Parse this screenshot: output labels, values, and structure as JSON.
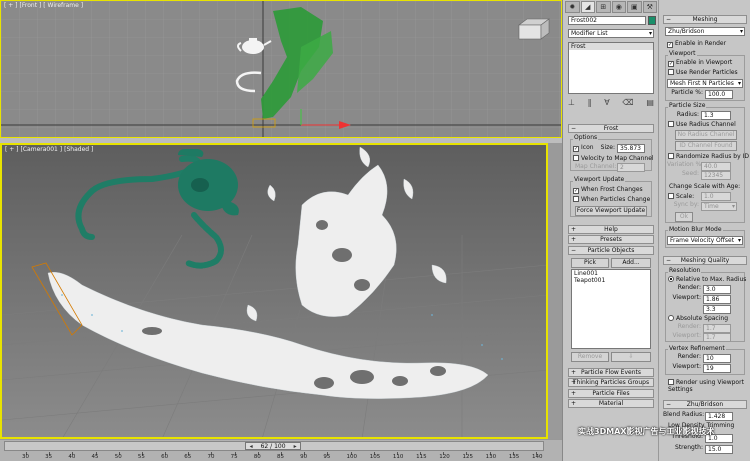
{
  "viewport_top": {
    "labels": [
      "[ + ]",
      "[Front ]",
      "[ Wireframe ]"
    ]
  },
  "viewport_camera": {
    "labels": [
      "[ + ]",
      "[Camera001 ]",
      "[Shaded ]"
    ]
  },
  "timeline": {
    "position": "62 / 100",
    "current_frame": 62,
    "total_frames": 100,
    "ticks": [
      "30",
      "35",
      "40",
      "45",
      "50",
      "55",
      "60",
      "65",
      "70",
      "75",
      "80",
      "85",
      "90",
      "95",
      "100",
      "105",
      "110",
      "115",
      "120",
      "125",
      "130",
      "135",
      "140"
    ]
  },
  "command_panel": {
    "tabs": [
      "create-icon",
      "modify-icon",
      "hierarchy-icon",
      "motion-icon",
      "display-icon",
      "utilities-icon"
    ],
    "object_name": "Frost002",
    "object_color": "#1a8f6a",
    "modifier_list": "Modifier List",
    "stack_item": "Frost",
    "frost_rollout": {
      "title": "Frost",
      "options_label": "Options",
      "icon_label": "Icon",
      "size_label": "Size:",
      "size_value": "35.873",
      "velocity_map": "Velocity to Map Channel",
      "map_channel_label": "Map Channel:",
      "map_channel_value": "2",
      "viewport_update_label": "Viewport Update",
      "when_frost_changes": "When Frost Changes",
      "when_particles_change": "When Particles Change",
      "force_update": "Force Viewport Update"
    },
    "rollouts_closed": [
      "Help",
      "Presets"
    ],
    "particle_objects": {
      "title": "Particle Objects",
      "pick": "Pick",
      "add": "Add...",
      "items": [
        "Line001",
        "Teapot001"
      ],
      "remove": "Remove"
    },
    "rollouts_bottom": [
      "Particle Flow Events",
      "Thinking Particles Groups",
      "Particle Files",
      "Material"
    ]
  },
  "meshing_panel": {
    "title": "Meshing",
    "method": "Zhu/Bridson",
    "enable_in_render": "Enable in Render",
    "viewport_label": "Viewport",
    "enable_in_viewport": "Enable in Viewport",
    "use_render_particles": "Use Render Particles",
    "mesh_mode": "Mesh First N Particles",
    "particle_pct_label": "Particle %:",
    "particle_pct_value": "100.0",
    "particle_size_label": "Particle Size",
    "radius_label": "Radius:",
    "radius_value": "1.3",
    "use_radius_channel": "Use Radius Channel",
    "no_radius_channel": "No Radius Channel",
    "id_channel_found": "ID Channel Found",
    "randomize_by_id": "Randomize Radius by ID",
    "variation_label": "Variation %:",
    "variation_value": "40.0",
    "seed_label": "Seed:",
    "seed_value": "12345",
    "change_scale_label": "Change Scale with Age:",
    "scale_label": "Scale:",
    "scale_value": "1.0",
    "sync_label": "Sync by:",
    "sync_value": "Time",
    "ok": "Ok",
    "motion_blur_label": "Motion Blur Mode",
    "motion_blur_value": "Frame Velocity Offset",
    "meshing_quality_title": "Meshing Quality",
    "resolution_label": "Resolution",
    "relative_label": "Relative to Max. Radius",
    "render_label": "Render:",
    "render_value": "3.0",
    "viewport_field_label": "Viewport:",
    "viewport_value": "1.86",
    "viewport_value2": "3.3",
    "absolute_spacing": "Absolute Spacing",
    "abs_render_value": "1.7",
    "abs_viewport_value": "1.7",
    "vertex_refinement": "Vertex Refinement",
    "vr_render_value": "10",
    "vr_viewport_value": "19",
    "render_using_viewport": "Render using Viewport Settings",
    "zhu_title": "Zhu/Bridson",
    "blend_radius_label": "Blend Radius:",
    "blend_radius_value": "1.428",
    "lowdensity_label": "Low Density Trimming",
    "threshold_label": "Threshold:",
    "threshold_value": "1.0",
    "strength_label": "Strength:",
    "strength_value": "15.0"
  },
  "watermark": "实战3DMAX影视广告与工业影视技术"
}
